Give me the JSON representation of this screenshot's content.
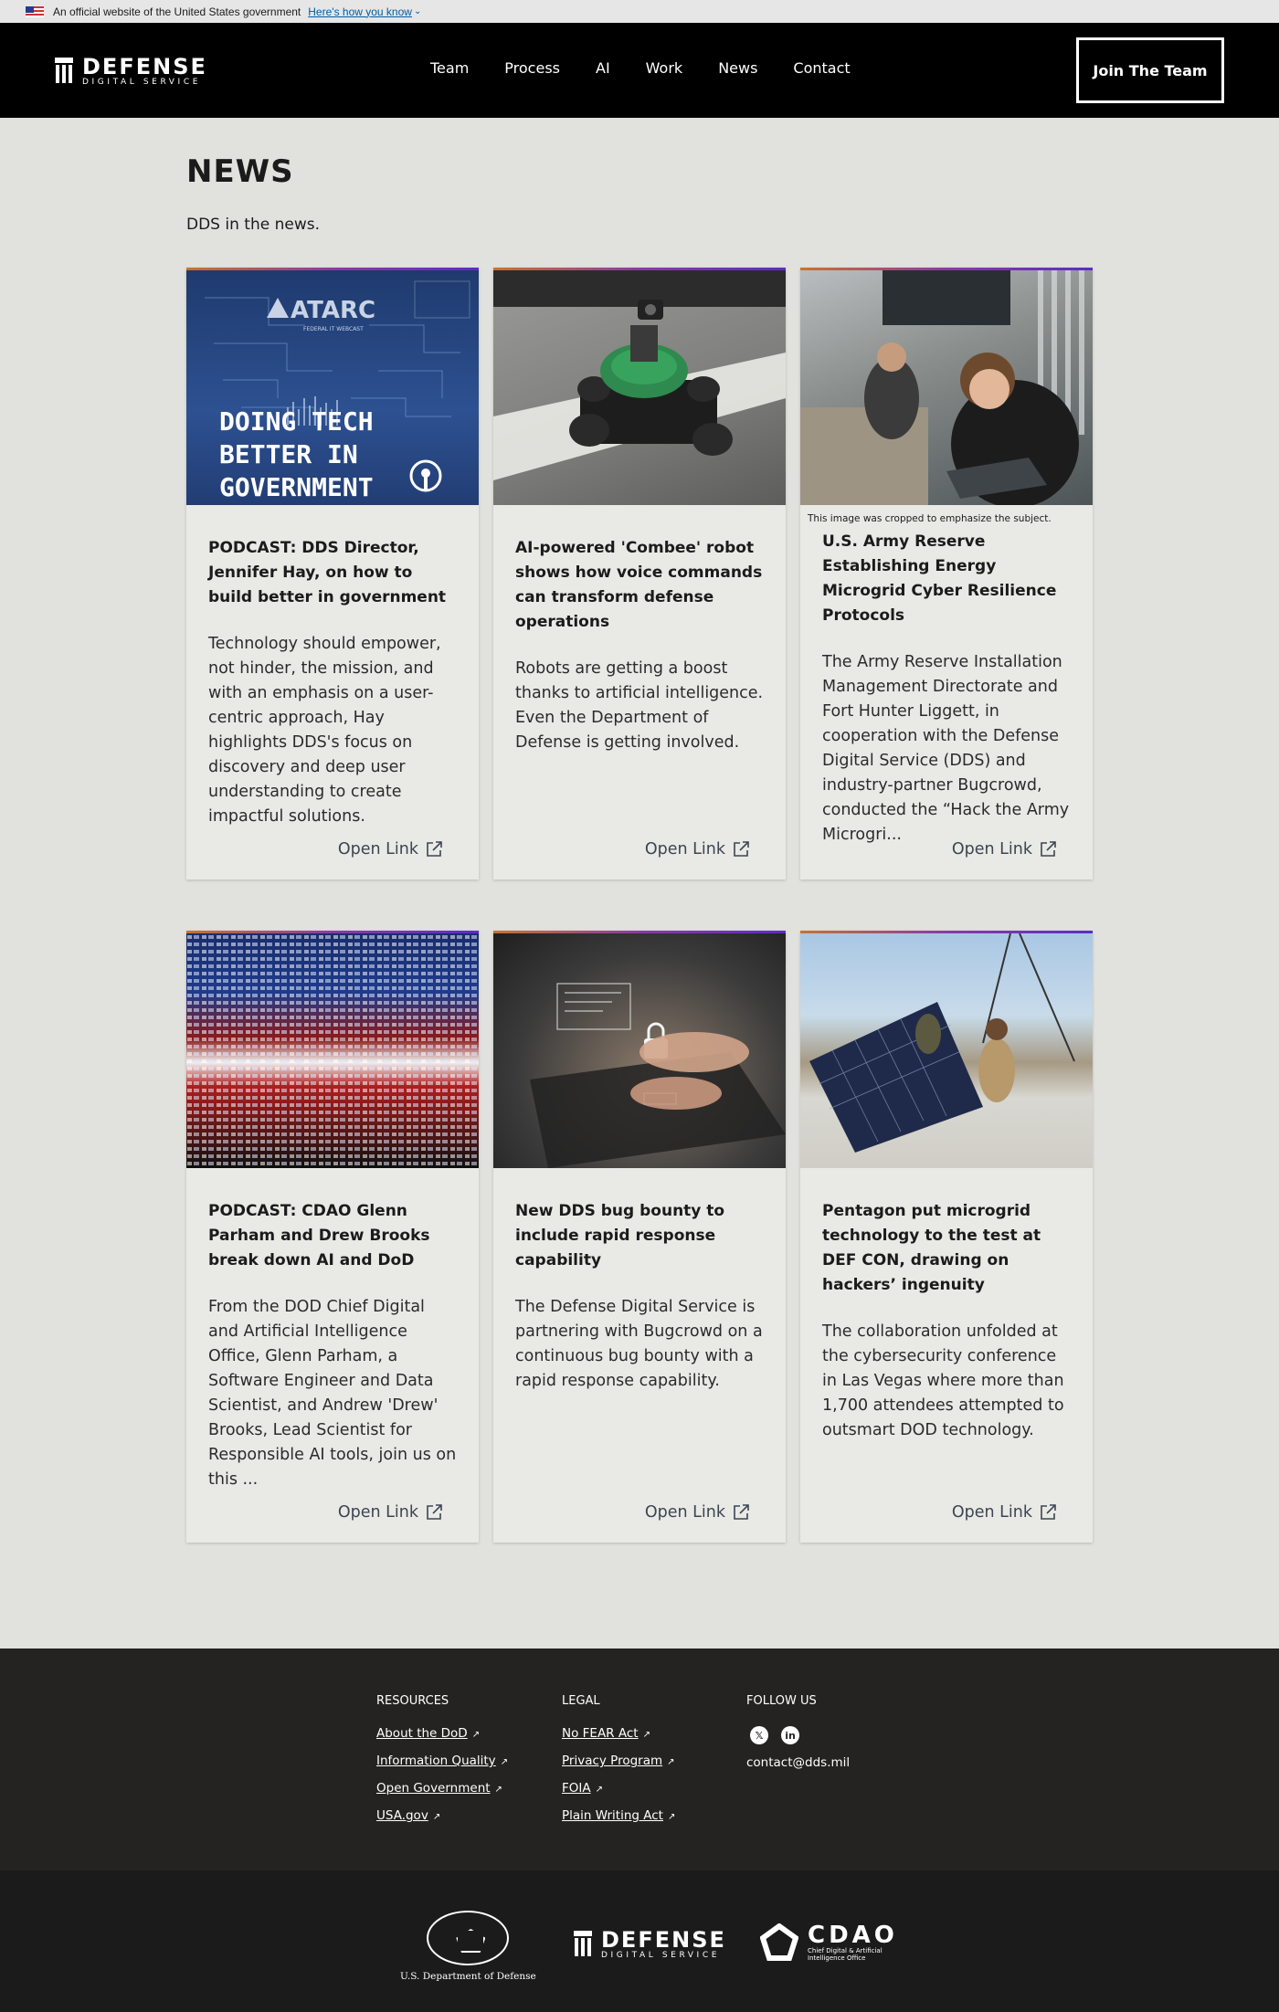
{
  "gov_banner": {
    "text": "An official website of the United States government",
    "link": "Here's how you know"
  },
  "header": {
    "logo_line1": "DEFENSE",
    "logo_line2": "DIGITAL SERVICE",
    "nav": [
      "Team",
      "Process",
      "AI",
      "Work",
      "News",
      "Contact"
    ],
    "cta": "Join The Team"
  },
  "page": {
    "title": "NEWS",
    "subtitle": "DDS in the news."
  },
  "cards": [
    {
      "image_text": [
        "ATARC",
        "FEDERAL IT WEBCAST",
        "DOING TECH",
        "BETTER IN",
        "GOVERNMENT"
      ],
      "caption": "",
      "title": "PODCAST: DDS Director, Jennifer Hay, on how to build better in government",
      "body": "Technology should empower, not hinder, the mission, and with an emphasis on a user-centric approach, Hay highlights DDS's focus on discovery and deep user understanding to create impactful solutions.",
      "link": "Open Link"
    },
    {
      "caption": "",
      "title": "AI-powered 'Combee' robot shows how voice commands can transform defense operations",
      "body": "Robots are getting a boost thanks to artificial intelligence. Even the Department of Defense is getting involved.",
      "link": "Open Link"
    },
    {
      "caption": "This image was cropped to emphasize the subject.",
      "title": "U.S. Army Reserve Establishing Energy Microgrid Cyber Resilience Protocols",
      "body": "The Army Reserve Installation Management Directorate and Fort Hunter Liggett, in cooperation with the Defense Digital Service (DDS) and industry-partner Bugcrowd, conducted the “Hack the Army Microgri...",
      "link": "Open Link"
    },
    {
      "caption": "",
      "title": "PODCAST: CDAO Glenn Parham and Drew Brooks break down AI and DoD",
      "body": "From the DOD Chief Digital and Artificial Intelligence Office, Glenn Parham, a Software Engineer and Data Scientist, and Andrew 'Drew' Brooks, Lead Scientist for Responsible AI tools, join us on this ...",
      "link": "Open Link"
    },
    {
      "caption": "",
      "title": "New DDS bug bounty to include rapid response capability",
      "body": "The Defense Digital Service is partnering with Bugcrowd on a continuous bug bounty with a rapid response capability.",
      "link": "Open Link"
    },
    {
      "caption": "",
      "title": "Pentagon put microgrid technology to the test at DEF CON, drawing on hackers’ ingenuity",
      "body": "The collaboration unfolded at the cybersecurity conference in Las Vegas where more than 1,700 attendees attempted to outsmart DOD technology.",
      "link": "Open Link"
    }
  ],
  "footer": {
    "resources": {
      "heading": "RESOURCES",
      "links": [
        "About the DoD",
        "Information Quality",
        "Open Government",
        "USA.gov"
      ]
    },
    "legal": {
      "heading": "LEGAL",
      "links": [
        "No FEAR Act",
        "Privacy Program",
        "FOIA",
        "Plain Writing Act"
      ]
    },
    "follow": {
      "heading": "FOLLOW US",
      "icons": [
        "x-icon",
        "linkedin-icon"
      ],
      "x_glyph": "𝕏",
      "linkedin_glyph": "in",
      "email": "contact@dds.mil"
    },
    "logos": {
      "dod": "U.S. Department of Defense",
      "dds_line1": "DEFENSE",
      "dds_line2": "DIGITAL SERVICE",
      "cdao_big": "CDAO",
      "cdao_small1": "Chief Digital & Artificial",
      "cdao_small2": "Intelligence Office"
    }
  }
}
